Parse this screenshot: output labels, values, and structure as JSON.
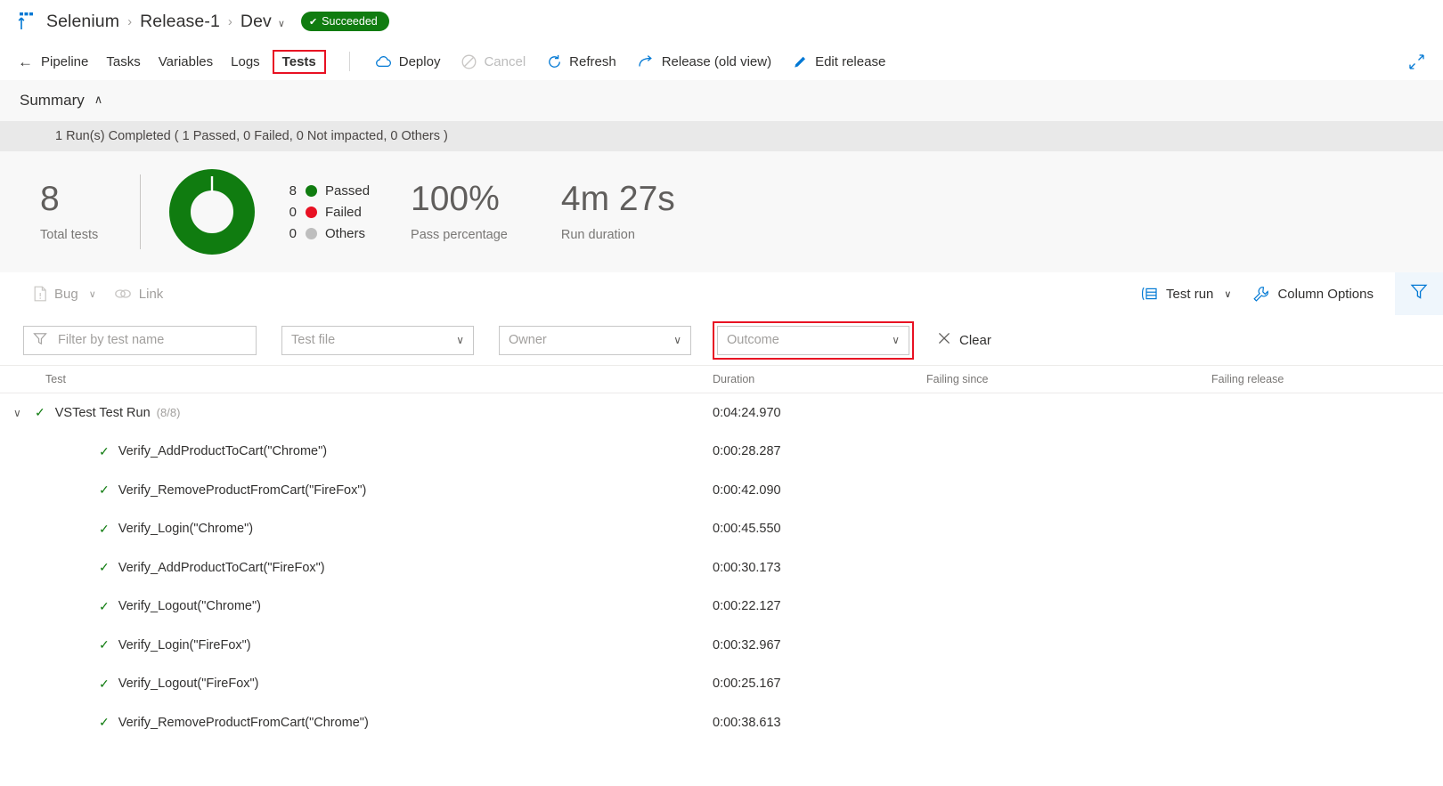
{
  "header": {
    "hub_icon": "pipelines-icon",
    "breadcrumb": [
      {
        "label": "Selenium",
        "name": "breadcrumb-project"
      },
      {
        "label": "Release-1",
        "name": "breadcrumb-release"
      },
      {
        "label": "Dev",
        "name": "breadcrumb-stage"
      }
    ],
    "separator": "›",
    "stage_caret": "∨",
    "status": {
      "label": "Succeeded",
      "check": "✔",
      "color": "#107c10"
    }
  },
  "toolbar": {
    "back_arrow": "←",
    "tabs": [
      {
        "label": "Pipeline",
        "active": false
      },
      {
        "label": "Tasks",
        "active": false
      },
      {
        "label": "Variables",
        "active": false
      },
      {
        "label": "Logs",
        "active": false
      },
      {
        "label": "Tests",
        "active": true
      }
    ],
    "commands": [
      {
        "label": "Deploy",
        "icon": "cloud-icon",
        "disabled": false
      },
      {
        "label": "Cancel",
        "icon": "cancel-icon",
        "disabled": true
      },
      {
        "label": "Refresh",
        "icon": "refresh-icon",
        "disabled": false
      },
      {
        "label": "Release (old view)",
        "icon": "arrow-redo-icon",
        "disabled": false
      },
      {
        "label": "Edit release",
        "icon": "pencil-icon",
        "disabled": false
      }
    ],
    "expand_icon": "fullscreen-icon"
  },
  "summary": {
    "title": "Summary",
    "collapse_caret": "∧",
    "run_status": "1 Run(s) Completed ( 1 Passed, 0 Failed, 0 Not impacted, 0 Others )",
    "total": {
      "value": "8",
      "label": "Total tests"
    },
    "pass_percentage": {
      "value": "100%",
      "label": "Pass percentage"
    },
    "run_duration": {
      "value": "4m 27s",
      "label": "Run duration"
    },
    "legend": [
      {
        "count": "8",
        "label": "Passed",
        "color": "#107c10"
      },
      {
        "count": "0",
        "label": "Failed",
        "color": "#e81123"
      },
      {
        "count": "0",
        "label": "Others",
        "color": "#bebebe"
      }
    ]
  },
  "chart_data": {
    "type": "pie",
    "title": "Test outcome distribution",
    "categories": [
      "Passed",
      "Failed",
      "Others"
    ],
    "values": [
      8,
      0,
      0
    ],
    "colors": [
      "#107c10",
      "#e81123",
      "#bebebe"
    ],
    "total": 8,
    "pass_percentage": 100,
    "legend_position": "right",
    "donut": true
  },
  "actions": {
    "bug": {
      "label": "Bug",
      "icon": "bug-document-icon",
      "caret": "∨"
    },
    "link": {
      "label": "Link",
      "icon": "link-icon"
    },
    "test_run": {
      "label": "Test run",
      "icon": "group-by-icon",
      "caret": "∨"
    },
    "column_options": {
      "label": "Column Options",
      "icon": "wrench-icon"
    },
    "filter": {
      "icon": "funnel-icon",
      "active": true
    }
  },
  "filters": {
    "test_name": {
      "placeholder": "Filter by test name",
      "value": "",
      "icon": "funnel-icon"
    },
    "test_file": {
      "value": "Test file",
      "caret": "∨"
    },
    "owner": {
      "value": "Owner",
      "caret": "∨"
    },
    "outcome": {
      "value": "Outcome",
      "caret": "∨",
      "highlighted": true
    },
    "clear": {
      "label": "Clear",
      "icon": "close-icon"
    }
  },
  "table": {
    "columns": [
      "Test",
      "Duration",
      "Failing since",
      "Failing release"
    ],
    "group": {
      "chevron": "∨",
      "name": "VSTest Test Run",
      "count": "(8/8)",
      "duration": "0:04:24.970",
      "failing_since": "",
      "failing_release": "",
      "outcome": "passed"
    },
    "rows": [
      {
        "name": "Verify_AddProductToCart(\"Chrome\")",
        "duration": "0:00:28.287",
        "failing_since": "",
        "failing_release": "",
        "outcome": "passed"
      },
      {
        "name": "Verify_RemoveProductFromCart(\"FireFox\")",
        "duration": "0:00:42.090",
        "failing_since": "",
        "failing_release": "",
        "outcome": "passed"
      },
      {
        "name": "Verify_Login(\"Chrome\")",
        "duration": "0:00:45.550",
        "failing_since": "",
        "failing_release": "",
        "outcome": "passed"
      },
      {
        "name": "Verify_AddProductToCart(\"FireFox\")",
        "duration": "0:00:30.173",
        "failing_since": "",
        "failing_release": "",
        "outcome": "passed"
      },
      {
        "name": "Verify_Logout(\"Chrome\")",
        "duration": "0:00:22.127",
        "failing_since": "",
        "failing_release": "",
        "outcome": "passed"
      },
      {
        "name": "Verify_Login(\"FireFox\")",
        "duration": "0:00:32.967",
        "failing_since": "",
        "failing_release": "",
        "outcome": "passed"
      },
      {
        "name": "Verify_Logout(\"FireFox\")",
        "duration": "0:00:25.167",
        "failing_since": "",
        "failing_release": "",
        "outcome": "passed"
      },
      {
        "name": "Verify_RemoveProductFromCart(\"Chrome\")",
        "duration": "0:00:38.613",
        "failing_since": "",
        "failing_release": "",
        "outcome": "passed"
      }
    ],
    "pass_check": "✓"
  }
}
